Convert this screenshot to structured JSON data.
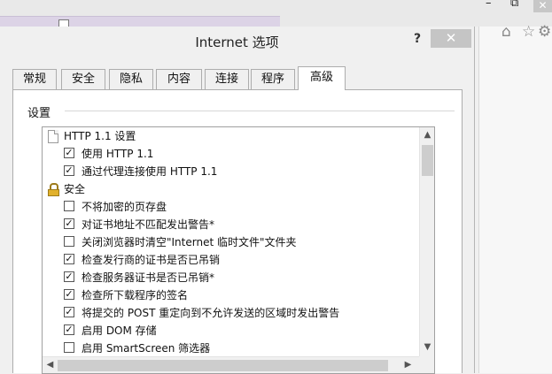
{
  "browser": {
    "window_buttons": {
      "minimize": "–",
      "restore": "⧉",
      "close": "✕"
    },
    "icons": [
      "home-icon",
      "star-icon",
      "gear-icon"
    ],
    "home_glyph": "⌂",
    "star_glyph": "☆",
    "gear_glyph": "⚙"
  },
  "dialog": {
    "title": "Internet 选项",
    "help_label": "?",
    "close_label": "✕",
    "tabs": [
      {
        "label": "常规"
      },
      {
        "label": "安全"
      },
      {
        "label": "隐私"
      },
      {
        "label": "内容"
      },
      {
        "label": "连接"
      },
      {
        "label": "程序"
      },
      {
        "label": "高级",
        "active": true
      }
    ],
    "settings": {
      "group_label": "设置",
      "items": [
        {
          "type": "header",
          "icon": "document-icon",
          "label": "HTTP 1.1 设置"
        },
        {
          "type": "checkbox",
          "checked": true,
          "label": "使用 HTTP 1.1"
        },
        {
          "type": "checkbox",
          "checked": true,
          "label": "通过代理连接使用 HTTP 1.1"
        },
        {
          "type": "header",
          "icon": "lock-icon",
          "label": "安全"
        },
        {
          "type": "checkbox",
          "checked": false,
          "label": "不将加密的页存盘"
        },
        {
          "type": "checkbox",
          "checked": true,
          "label": "对证书地址不匹配发出警告*"
        },
        {
          "type": "checkbox",
          "checked": false,
          "label": "关闭浏览器时清空\"Internet 临时文件\"文件夹"
        },
        {
          "type": "checkbox",
          "checked": true,
          "label": "检查发行商的证书是否已吊销"
        },
        {
          "type": "checkbox",
          "checked": true,
          "label": "检查服务器证书是否已吊销*"
        },
        {
          "type": "checkbox",
          "checked": true,
          "label": "检查所下载程序的签名"
        },
        {
          "type": "checkbox",
          "checked": true,
          "label": "将提交的 POST 重定向到不允许发送的区域时发出警告"
        },
        {
          "type": "checkbox",
          "checked": true,
          "label": "启用 DOM 存储"
        },
        {
          "type": "checkbox",
          "checked": false,
          "label": "启用 SmartScreen 筛选器"
        }
      ],
      "scroll_up": "▲",
      "scroll_down": "▼",
      "scroll_left": "◀",
      "scroll_right": "▶"
    }
  }
}
